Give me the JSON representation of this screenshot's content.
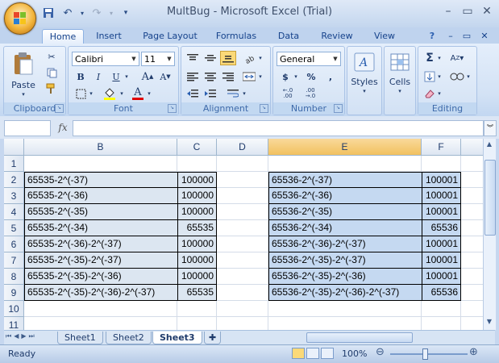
{
  "window": {
    "title": "MultBug - Microsoft Excel (Trial)"
  },
  "tabs": [
    "Home",
    "Insert",
    "Page Layout",
    "Formulas",
    "Data",
    "Review",
    "View"
  ],
  "active_tab": "Home",
  "ribbon": {
    "clipboard": {
      "label": "Clipboard",
      "paste": "Paste"
    },
    "font": {
      "label": "Font",
      "font_name": "Calibri",
      "font_size": "11"
    },
    "alignment": {
      "label": "Alignment"
    },
    "number": {
      "label": "Number",
      "format": "General"
    },
    "styles": {
      "label": "Styles"
    },
    "cells": {
      "label": "Cells"
    },
    "editing": {
      "label": "Editing"
    }
  },
  "formula_bar": {
    "name_box": "",
    "fx": "fx",
    "formula": ""
  },
  "grid": {
    "columns": [
      "B",
      "C",
      "D",
      "E",
      "F"
    ],
    "rows": [
      "1",
      "2",
      "3",
      "4",
      "5",
      "6",
      "7",
      "8",
      "9",
      "10",
      "11"
    ],
    "left_table": [
      {
        "text": "65535-2^(-37)",
        "value": "100000"
      },
      {
        "text": "65535-2^(-36)",
        "value": "100000"
      },
      {
        "text": "65535-2^(-35)",
        "value": "100000"
      },
      {
        "text": "65535-2^(-34)",
        "value": "65535"
      },
      {
        "text": "65535-2^(-36)-2^(-37)",
        "value": "100000"
      },
      {
        "text": "65535-2^(-35)-2^(-37)",
        "value": "100000"
      },
      {
        "text": "65535-2^(-35)-2^(-36)",
        "value": "100000"
      },
      {
        "text": "65535-2^(-35)-2^(-36)-2^(-37)",
        "value": "65535"
      }
    ],
    "right_table": [
      {
        "text": "65536-2^(-37)",
        "value": "100001"
      },
      {
        "text": "65536-2^(-36)",
        "value": "100001"
      },
      {
        "text": "65536-2^(-35)",
        "value": "100001"
      },
      {
        "text": "65536-2^(-34)",
        "value": "65536"
      },
      {
        "text": "65536-2^(-36)-2^(-37)",
        "value": "100001"
      },
      {
        "text": "65536-2^(-35)-2^(-37)",
        "value": "100001"
      },
      {
        "text": "65536-2^(-35)-2^(-36)",
        "value": "100001"
      },
      {
        "text": "65536-2^(-35)-2^(-36)-2^(-37)",
        "value": "65536"
      }
    ]
  },
  "sheets": [
    "Sheet1",
    "Sheet2",
    "Sheet3"
  ],
  "active_sheet": "Sheet3",
  "status": {
    "text": "Ready",
    "zoom": "100%"
  },
  "colors": {
    "ribbon": "#dbe7f6",
    "selection": "#f1c15f",
    "table_left": "#dce6f1",
    "table_right": "#c5d9f1"
  }
}
